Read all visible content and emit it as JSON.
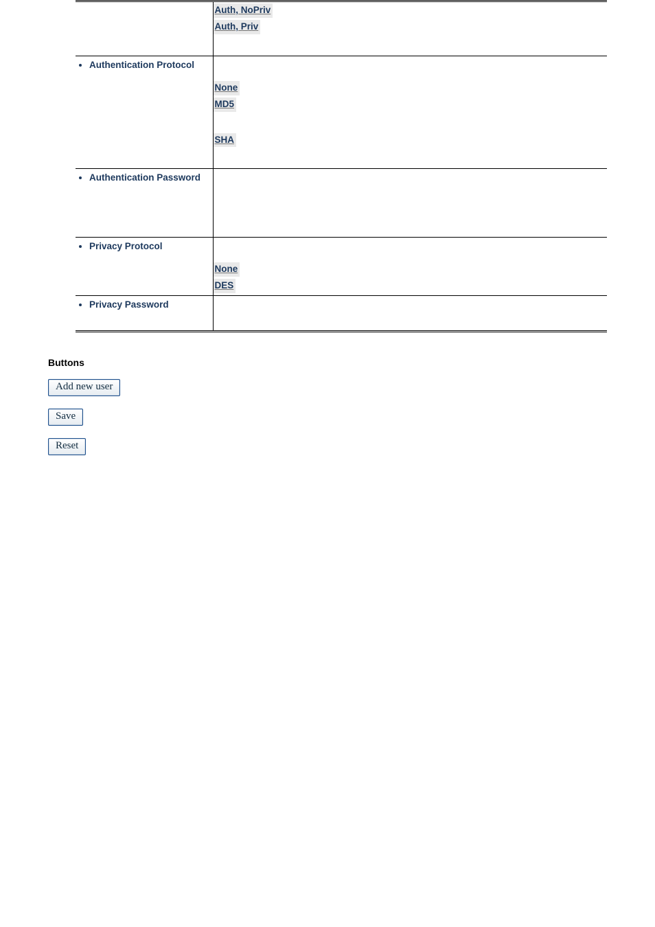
{
  "spec_rows": [
    {
      "id": "security-level",
      "label": "",
      "options": [
        {
          "text": "Auth, NoPriv"
        },
        {
          "text": "Auth, Priv"
        }
      ],
      "leading_space": false,
      "trailing_space": true
    },
    {
      "id": "auth-protocol",
      "label": "Authentication Protocol",
      "options": [
        {
          "text": "None"
        },
        {
          "text": "MD5"
        },
        {
          "text": "SHA",
          "gap_before": true
        }
      ],
      "leading_space": true,
      "trailing_space": true
    },
    {
      "id": "auth-password",
      "label": "Authentication Password",
      "options": [],
      "leading_space": false,
      "trailing_space": true,
      "min_height": 100
    },
    {
      "id": "privacy-protocol",
      "label": "Privacy Protocol",
      "options": [
        {
          "text": "None"
        },
        {
          "text": "DES"
        }
      ],
      "leading_space": true,
      "trailing_space": false
    },
    {
      "id": "privacy-password",
      "label": "Privacy Password",
      "options": [],
      "leading_space": false,
      "trailing_space": false,
      "min_height": 52
    }
  ],
  "buttons_heading": "Buttons",
  "buttons": [
    {
      "id": "add-new-user",
      "label": "Add new user"
    },
    {
      "id": "save",
      "label": "Save"
    },
    {
      "id": "reset",
      "label": "Reset"
    }
  ]
}
